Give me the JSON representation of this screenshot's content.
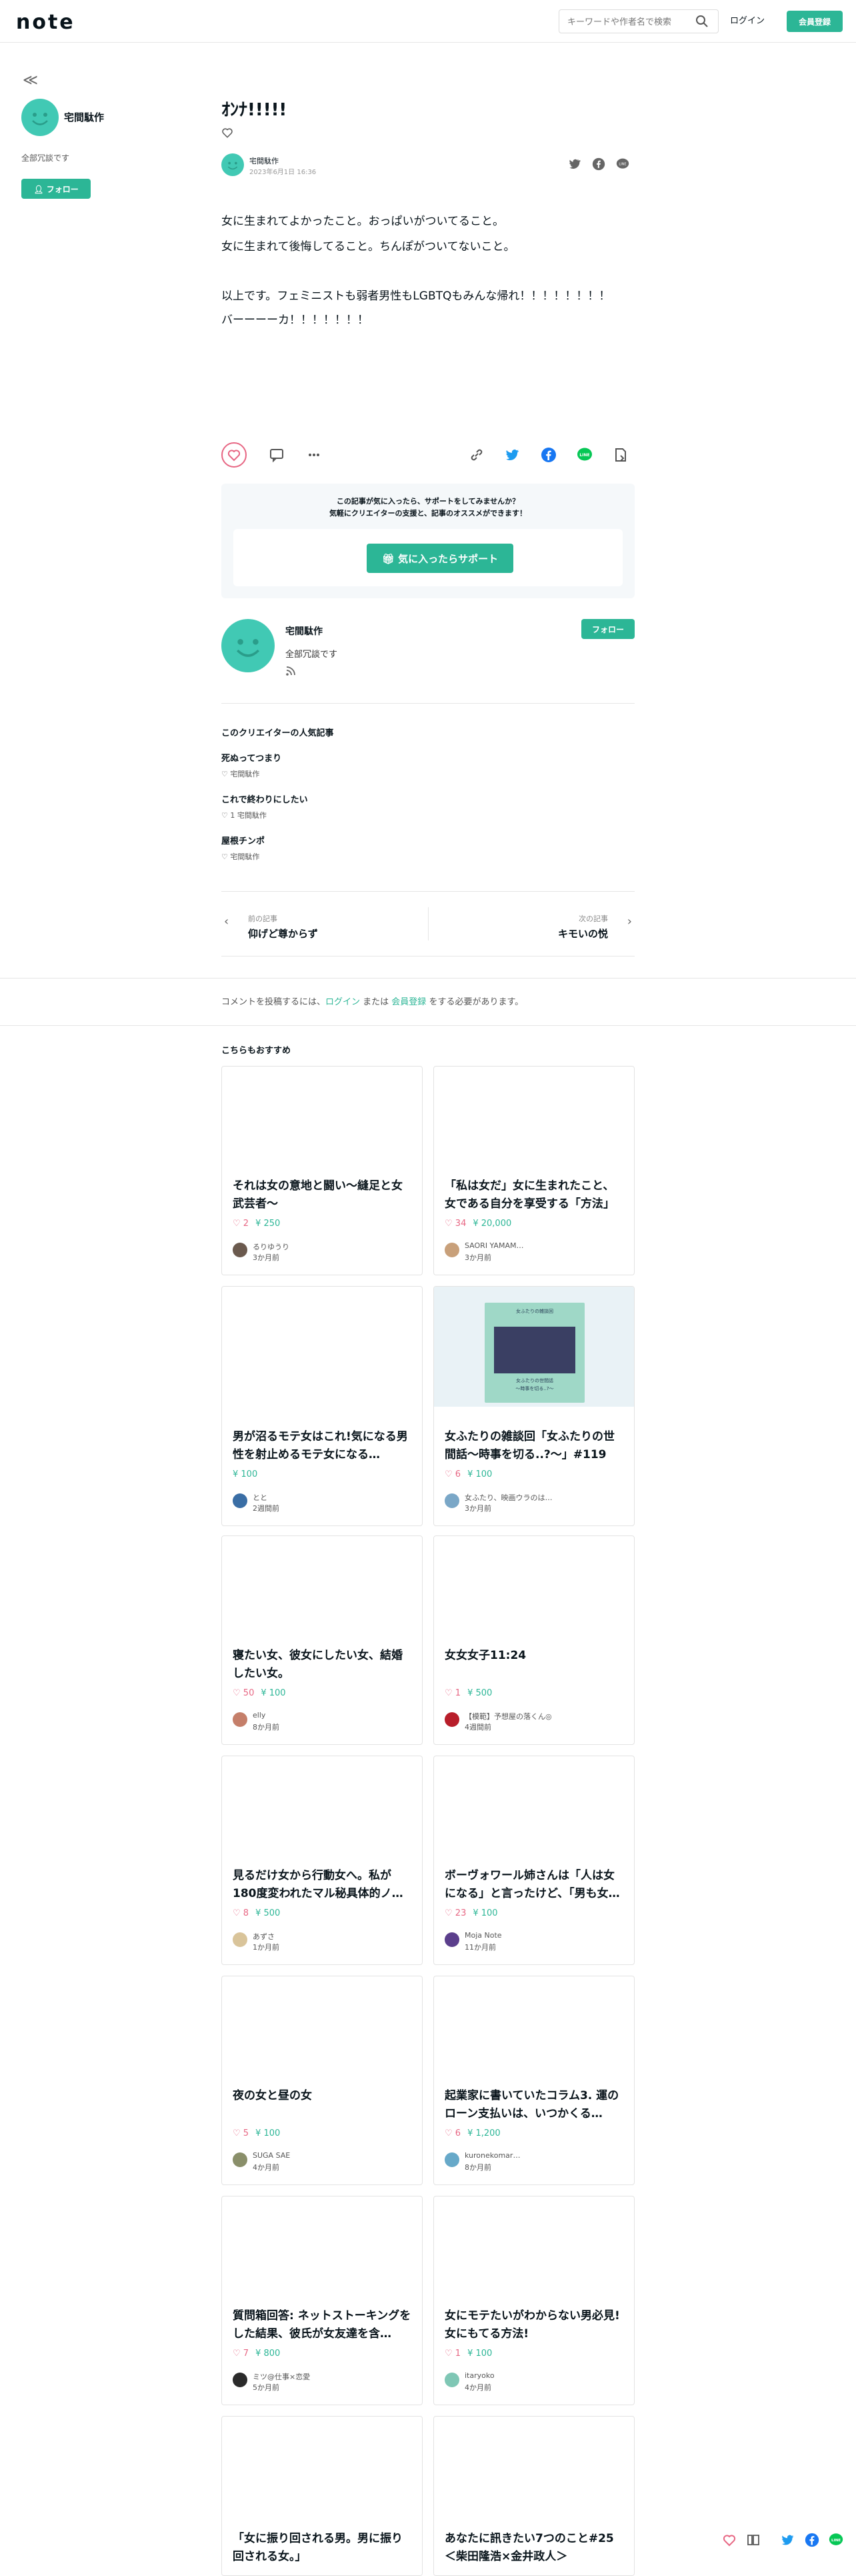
{
  "header": {
    "logo": "note",
    "search_placeholder": "キーワードや作者名で検索",
    "login": "ログイン",
    "signup": "会員登録"
  },
  "sidebar": {
    "collapse": "≪",
    "creator_name": "宅間駄作",
    "bio": "全部冗談です",
    "follow": "フォロー"
  },
  "article": {
    "title": "ｵﾝﾅ!!!!!",
    "author": "宅間駄作",
    "date": "2023年6月1日 16:36",
    "body": [
      "女に生まれてよかったこと。おっぱいがついてること。",
      "女に生まれて後悔してること。ちんぽがついてないこと。",
      "",
      "以上です。フェミニストも弱者男性もLGBTQもみんな帰れ！！！！！！！！",
      "バーーーーカ！！！！！！！"
    ]
  },
  "support": {
    "line1": "この記事が気に入ったら、サポートをしてみませんか？",
    "line2": "気軽にクリエイターの支援と、記事のオススメができます！",
    "button": "気に入ったらサポート"
  },
  "author_card": {
    "name": "宅間駄作",
    "bio": "全部冗談です",
    "follow": "フォロー"
  },
  "popular": {
    "heading": "このクリエイターの人気記事",
    "items": [
      {
        "title": "死ぬってつまり",
        "meta": "宅間駄作"
      },
      {
        "title": "これで終わりにしたい",
        "meta": "1  宅間駄作"
      },
      {
        "title": "屋根チンポ",
        "meta": "宅間駄作"
      }
    ]
  },
  "nav": {
    "prev_label": "前の記事",
    "prev_title": "仰げど尊からず",
    "next_label": "次の記事",
    "next_title": "キモいの悦"
  },
  "comment": {
    "pre": "コメントを投稿するには、",
    "login": "ログイン",
    "mid": " または ",
    "signup": "会員登録",
    "post": " をする必要があります。"
  },
  "recommend": {
    "heading": "こちらもおすすめ",
    "cards": [
      {
        "title": "それは女の意地と闘い〜縫足と女武芸者〜",
        "likes": "2",
        "price": "250",
        "author": "るりゆうり",
        "time": "3か月前"
      },
      {
        "title": "「私は女だ」女に生まれたこと、女である自分を享受する「方法」",
        "likes": "34",
        "price": "20,000",
        "author": "SAORI YAMAM…",
        "time": "3か月前"
      },
      {
        "title": "男が沼るモテ女はこれ!気になる男性を射止めるモテ女になる…",
        "likes": "",
        "price": "100",
        "author": "とと",
        "time": "2週間前"
      },
      {
        "title": "女ふたりの雑談回「女ふたりの世間話〜時事を切る..?〜」#119",
        "likes": "6",
        "price": "100",
        "author": "女ふたり、映画ウラのは…",
        "time": "3か月前"
      },
      {
        "title": "寝たい女、彼女にしたい女、結婚したい女。",
        "likes": "50",
        "price": "100",
        "author": "elly",
        "time": "8か月前"
      },
      {
        "title": "女女女子11:24",
        "likes": "1",
        "price": "500",
        "author": "【模範】予想屋の落くん◎",
        "time": "4週間前"
      },
      {
        "title": "見るだけ女から行動女へ。私が180度変われたマル秘具体的ノ…",
        "likes": "8",
        "price": "500",
        "author": "あずさ",
        "time": "1か月前"
      },
      {
        "title": "ボーヴォワール姉さんは「人は女になる」と言ったけど、「男も女…",
        "likes": "23",
        "price": "100",
        "author": "Moja Note",
        "time": "11か月前"
      },
      {
        "title": "夜の女と昼の女",
        "likes": "5",
        "price": "100",
        "author": "SUGA SAE",
        "time": "4か月前"
      },
      {
        "title": "起業家に書いていたコラム3. 運のローン支払いは、いつかくる…",
        "likes": "6",
        "price": "1,200",
        "author": "kuronekomar…",
        "time": "8か月前"
      },
      {
        "title": "質問箱回答: ネットストーキングをした結果、彼氏が女友達を含…",
        "likes": "7",
        "price": "800",
        "author": "ミツ@仕事×恋愛",
        "time": "5か月前"
      },
      {
        "title": "女にモテたいがわからない男必見!女にもてる方法!",
        "likes": "1",
        "price": "100",
        "author": "itaryoko",
        "time": "4か月前"
      },
      {
        "title": "「女に振り回される男。男に振り回される女。」",
        "likes": "",
        "price": "",
        "author": "",
        "time": ""
      },
      {
        "title": "あなたに訊きたい7つのこと#25＜柴田隆浩×金井政人＞",
        "likes": "",
        "price": "",
        "author": "",
        "time": ""
      }
    ],
    "thumb_lines": [
      "女ふたりの雑談回",
      "女ふたりの世間話",
      "〜時事を切る..?〜"
    ]
  },
  "colors": {
    "brand": "#2cb696",
    "like": "#e76683",
    "avatar": "#41c9b4"
  }
}
